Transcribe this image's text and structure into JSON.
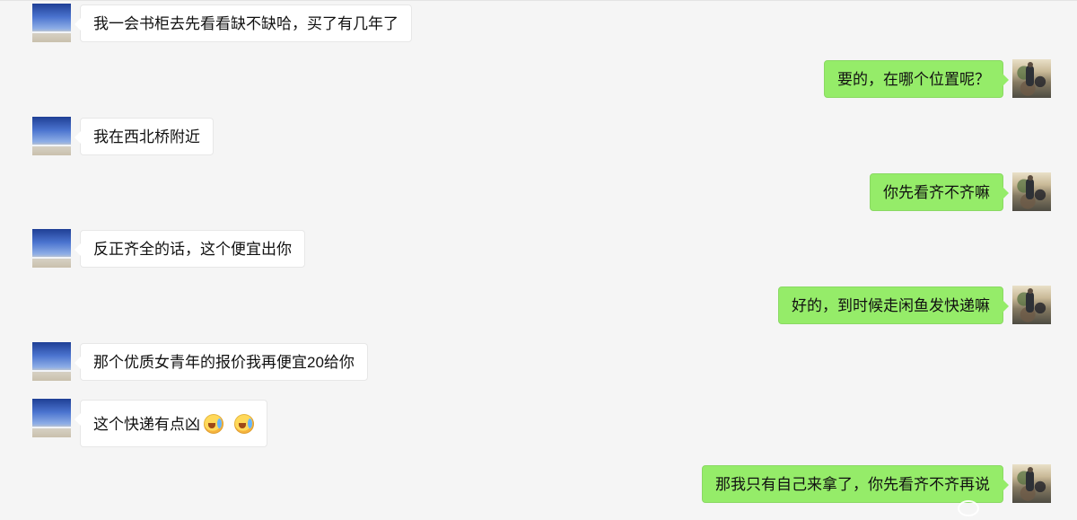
{
  "chat": {
    "messages": [
      {
        "side": "left",
        "text": "我一会书柜去先看看缺不缺哈，买了有几年了"
      },
      {
        "side": "right",
        "text": "要的，在哪个位置呢？"
      },
      {
        "side": "left",
        "text": "我在西北桥附近"
      },
      {
        "side": "right",
        "text": "你先看齐不齐嘛"
      },
      {
        "side": "left",
        "text": "反正齐全的话，这个便宜出你"
      },
      {
        "side": "right",
        "text": "好的，到时候走闲鱼发快递嘛"
      },
      {
        "side": "left",
        "text": "那个优质女青年的报价我再便宜20给你"
      },
      {
        "side": "left",
        "text": "这个快递有点凶"
      },
      {
        "side": "right",
        "text": "那我只有自己来拿了，你先看齐不齐再说"
      }
    ]
  },
  "icons": {
    "emoji_1": "crying-laughing-emoji",
    "emoji_2": "crying-laughing-emoji"
  },
  "colors": {
    "background": "#f5f5f5",
    "received_bubble": "#ffffff",
    "sent_bubble": "#95ec69"
  }
}
